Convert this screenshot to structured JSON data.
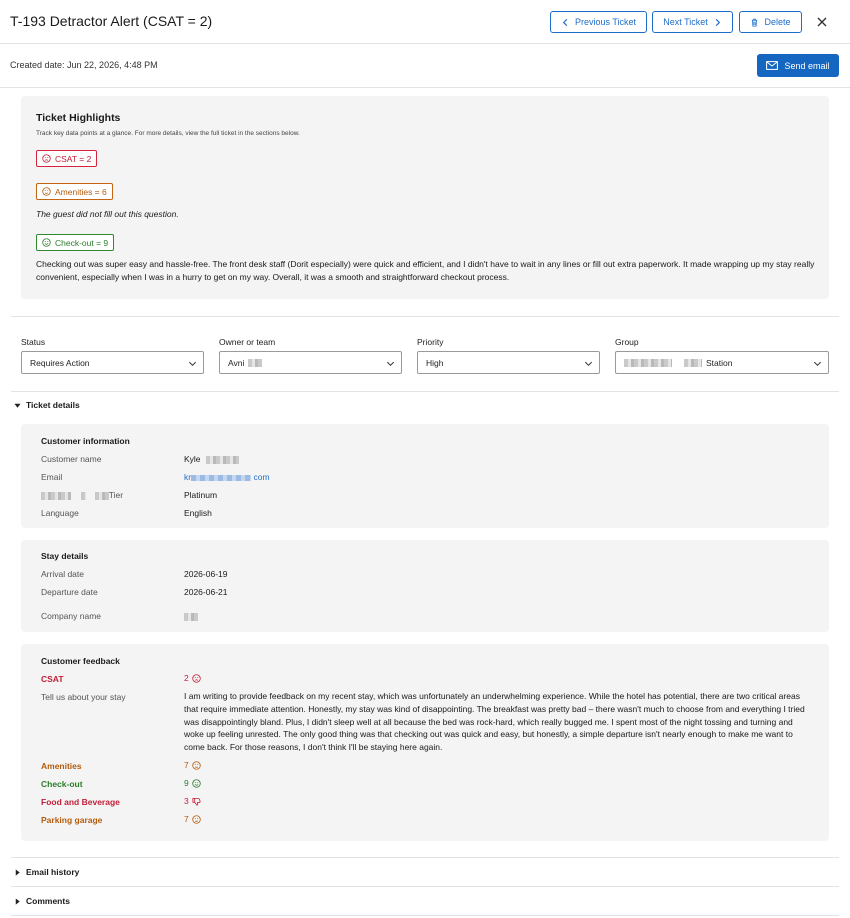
{
  "header": {
    "title": "T-193 Detractor Alert (CSAT = 2)",
    "prev_label": "Previous Ticket",
    "next_label": "Next Ticket",
    "delete_label": "Delete"
  },
  "subbar": {
    "created": "Created date: Jun 22, 2026, 4:48 PM",
    "send_label": "Send email"
  },
  "highlights": {
    "title": "Ticket Highlights",
    "subtitle": "Track key data points at a glance. For more details, view the full ticket in the sections below.",
    "items": [
      {
        "label": "CSAT = 2",
        "text": ""
      },
      {
        "label": "Amenities = 6",
        "text": "The guest did not fill out this question."
      },
      {
        "label": "Check-out = 9",
        "text": "Checking out was super easy and hassle-free. The front desk staff (Dorit especially) were quick and efficient, and I didn't have to wait in any lines or fill out extra paperwork. It made wrapping up my stay really convenient, especially when I was in a hurry to get on my way. Overall, it was a smooth and straightforward checkout process."
      }
    ]
  },
  "fields": {
    "status": {
      "label": "Status",
      "value": "Requires Action"
    },
    "owner": {
      "label": "Owner or team",
      "value": "Avni"
    },
    "priority": {
      "label": "Priority",
      "value": "High"
    },
    "group": {
      "label": "Group",
      "value": "Station"
    }
  },
  "ticket_details": {
    "toggle_label": "Ticket details",
    "customer": {
      "title": "Customer information",
      "name_label": "Customer name",
      "name_value": "Kyle",
      "email_label": "Email",
      "email_prefix": "kr",
      "email_suffix": "com",
      "tier_label": "Tier",
      "tier_value": "Platinum",
      "language_label": "Language",
      "language_value": "English"
    },
    "stay": {
      "title": "Stay details",
      "arrival_label": "Arrival date",
      "arrival_value": "2026-06-19",
      "departure_label": "Departure date",
      "departure_value": "2026-06-21",
      "company_label": "Company name"
    },
    "feedback": {
      "title": "Customer feedback",
      "csat_label": "CSAT",
      "csat_value": "2",
      "stay_label": "Tell us about your stay",
      "stay_text": "I am writing to provide feedback on my recent stay, which was unfortunately an underwhelming experience. While the hotel has potential, there are two critical areas that require immediate attention. Honestly, my stay was kind of disappointing. The breakfast was pretty bad – there wasn't much to choose from and everything I tried was disappointingly bland. Plus, I didn't sleep well at all because the bed was rock-hard, which really bugged me. I spent most of the night tossing and turning and woke up feeling unrested. The only good thing was that checking out was quick and easy, but honestly, a simple departure isn't nearly enough to make me want to come back. For those reasons, I don't think I'll be staying here again.",
      "amenities_label": "Amenities",
      "amenities_value": "7",
      "checkout_label": "Check-out",
      "checkout_value": "9",
      "food_label": "Food and Beverage",
      "food_value": "3",
      "parking_label": "Parking garage",
      "parking_value": "7"
    }
  },
  "sections": {
    "email_history": "Email history",
    "comments": "Comments"
  },
  "colors": {
    "accent": "#1566c0",
    "red": "#c21d35",
    "orange": "#b45c0c",
    "green": "#2a7d2a"
  }
}
